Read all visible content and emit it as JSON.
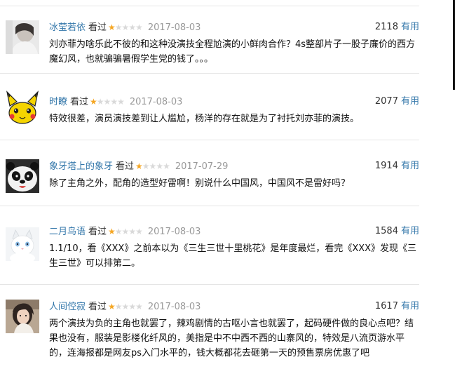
{
  "comments": [
    {
      "user": "冰莹若依",
      "watched": "看过",
      "rating": 1,
      "date": "2017-08-03",
      "votes": "2118",
      "useful": "有用",
      "text": "刘亦菲为啥乐此不彼的和这种没演技全程尬演的小鲜肉合作？4s整部片子一股子廉价的西方魔幻风，也就骗骗暑假学生党的钱了。。。",
      "avatar": "portrait-photo"
    },
    {
      "user": "时瞭",
      "watched": "看过",
      "rating": 1,
      "date": "2017-08-03",
      "votes": "2077",
      "useful": "有用",
      "text": "特效很差，演员演技差到让人尴尬，杨洋的存在就是为了衬托刘亦菲的演技。",
      "avatar": "yellow-cartoon-character"
    },
    {
      "user": "象牙塔上的象牙",
      "watched": "看过",
      "rating": 1,
      "date": "2017-07-29",
      "votes": "1914",
      "useful": "有用",
      "text": "除了主角之外，配角的造型好雷啊！别说什么中国风，中国风不是雷好吗？",
      "avatar": "panda-face"
    },
    {
      "user": "二月鸟语",
      "watched": "看过",
      "rating": 1,
      "date": "2017-08-03",
      "votes": "1584",
      "useful": "有用",
      "text": "1.1/10，看《XXX》之前本以为《三生三世十里桃花》是年度最烂，看完《XXX》发现《三生三世》可以排第二。",
      "avatar": "white-kitten"
    },
    {
      "user": "人间倥寂",
      "watched": "看过",
      "rating": 1,
      "date": "2017-08-03",
      "votes": "1617",
      "useful": "有用",
      "text": "两个演技为负的主角也就罢了，辣鸡剧情的古呕小言也就罢了，起码硬件做的良心点吧？结果也没有，服装是影楼化纤风的，美指是中不中西不西的山寨风的，特效是八流页游水平的，连海报都是网友ps入门水平的，钱大概都花去砸第一天的预售票房优惠了吧",
      "avatar": "girl-portrait-photo"
    }
  ]
}
